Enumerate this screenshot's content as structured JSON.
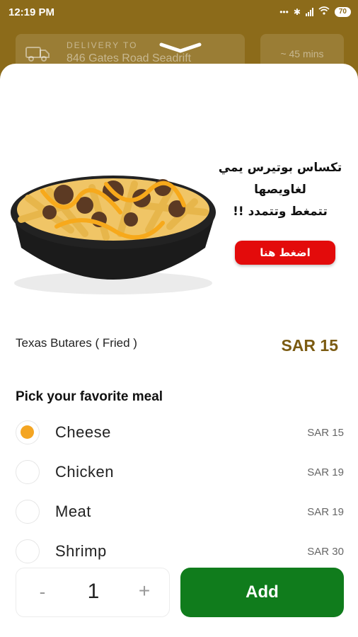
{
  "status_bar": {
    "time": "12:19 PM",
    "battery": "70"
  },
  "header": {
    "delivery_label": "DELIVERY TO",
    "address": "846 Gates Road Seadrift",
    "eta": "~ 45 mins"
  },
  "promo": {
    "line1": "تكساس بوتيرس يمي",
    "line2": "لغاويصها",
    "line3": "تتمغط وتتمدد !!",
    "button_label": "اضغط هنا"
  },
  "item": {
    "name": "Texas Butares ( Fried )",
    "price": "SAR 15"
  },
  "options_section": {
    "title": "Pick your favorite meal",
    "options": [
      {
        "name": "Cheese",
        "price": "SAR 15",
        "selected": true
      },
      {
        "name": "Chicken",
        "price": "SAR 19",
        "selected": false
      },
      {
        "name": "Meat",
        "price": "SAR 19",
        "selected": false
      },
      {
        "name": "Shrimp",
        "price": "SAR 30",
        "selected": false
      }
    ]
  },
  "quantity": {
    "minus": "-",
    "value": "1",
    "plus": "+"
  },
  "add_button": {
    "label": "Add"
  },
  "colors": {
    "brand": "#8c6b1a",
    "accent": "#f4a522",
    "add": "#107c1c",
    "promo_button": "#e30b0b",
    "price": "#7b5b12"
  }
}
